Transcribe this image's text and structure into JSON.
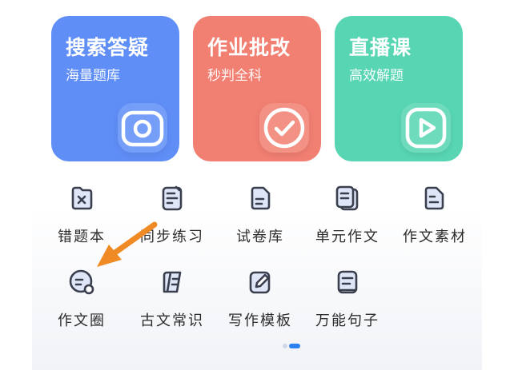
{
  "cards": [
    {
      "title": "搜索答疑",
      "subtitle": "海量题库",
      "icon": "camera-icon",
      "color": "#5f8ef7"
    },
    {
      "title": "作业批改",
      "subtitle": "秒判全科",
      "icon": "check-icon",
      "color": "#f17f72"
    },
    {
      "title": "直播课",
      "subtitle": "高效解题",
      "icon": "play-icon",
      "color": "#58d6b3"
    }
  ],
  "grid": [
    {
      "label": "错题本",
      "icon": "wrong-book-icon"
    },
    {
      "label": "同步练习",
      "icon": "practice-icon"
    },
    {
      "label": "试卷库",
      "icon": "exam-library-icon"
    },
    {
      "label": "单元作文",
      "icon": "unit-essay-icon"
    },
    {
      "label": "作文素材",
      "icon": "essay-material-icon"
    },
    {
      "label": "作文圈",
      "icon": "essay-circle-icon"
    },
    {
      "label": "古文常识",
      "icon": "ancient-text-icon"
    },
    {
      "label": "写作模板",
      "icon": "writing-template-icon"
    },
    {
      "label": "万能句子",
      "icon": "sentence-icon"
    }
  ],
  "colors": {
    "icon_stroke": "#3a3f4e",
    "icon_fill": "#dfe6f7",
    "annotation_arrow": "#f08a24",
    "page_indicator_active": "#2c7ff0"
  },
  "pager": {
    "count": 2,
    "active_index": 1
  },
  "annotation": {
    "type": "arrow",
    "points_to": "作文圈"
  }
}
